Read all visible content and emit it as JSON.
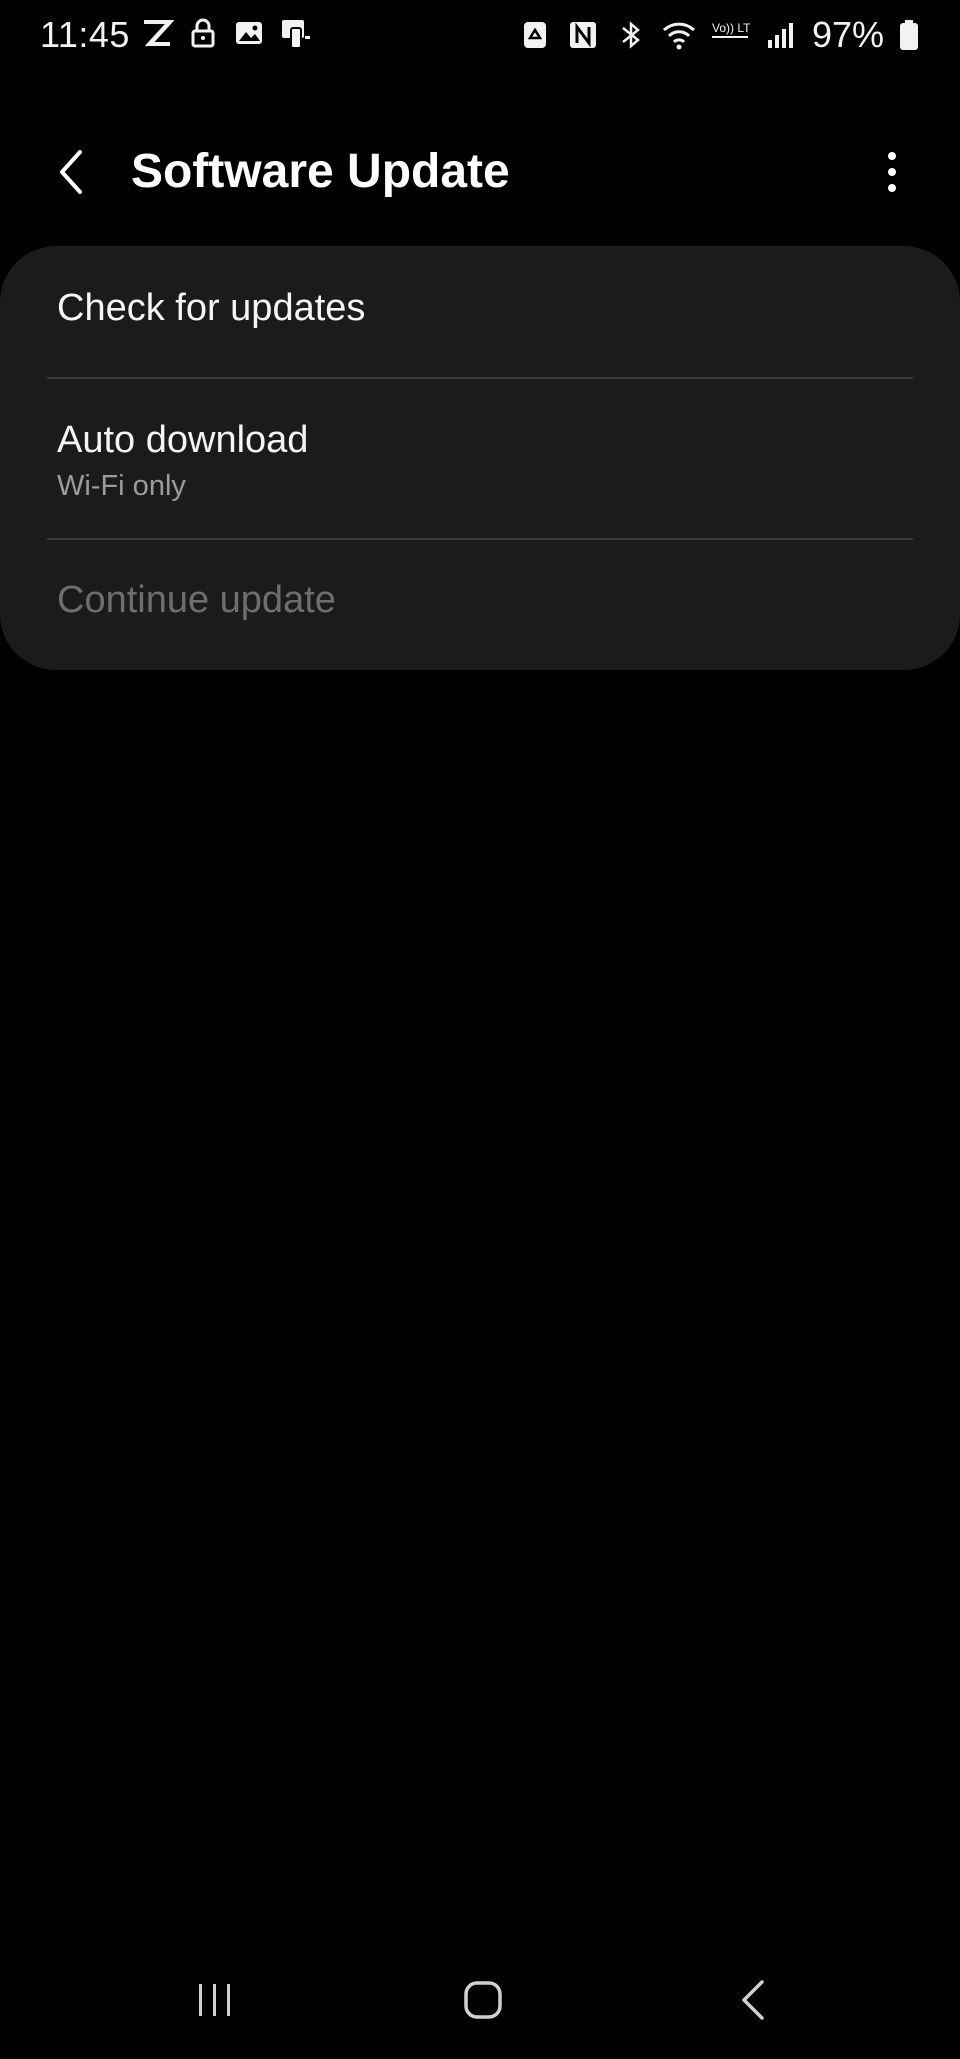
{
  "status_bar": {
    "time": "11:45",
    "battery_percent": "97%",
    "left_icons": [
      "z-app-icon",
      "lock-icon",
      "image-icon",
      "cast-icon"
    ],
    "right_icons": [
      "recycle-icon",
      "nfc-icon",
      "bluetooth-icon",
      "wifi-icon",
      "volte-icon",
      "signal-icon",
      "battery-icon"
    ],
    "volte_label": "Vo)) LTE1",
    "battery_level": 0.97
  },
  "header": {
    "title": "Software Update",
    "back_icon": "chevron-left-icon",
    "more_icon": "more-vertical-icon"
  },
  "menu": {
    "items": [
      {
        "title": "Check for updates",
        "enabled": true
      },
      {
        "title": "Auto download",
        "subtitle": "Wi-Fi only",
        "enabled": true
      },
      {
        "title": "Continue update",
        "enabled": false
      }
    ]
  },
  "nav_bar": {
    "recents_icon": "recents-icon",
    "home_icon": "home-icon",
    "back_icon": "nav-back-icon"
  },
  "colors": {
    "background": "#000000",
    "card": "#1b1b1b",
    "text_primary": "#f5f5f5",
    "text_secondary": "#9b9b9b",
    "text_disabled": "#6e6e6e",
    "divider": "#3a3a3a"
  }
}
